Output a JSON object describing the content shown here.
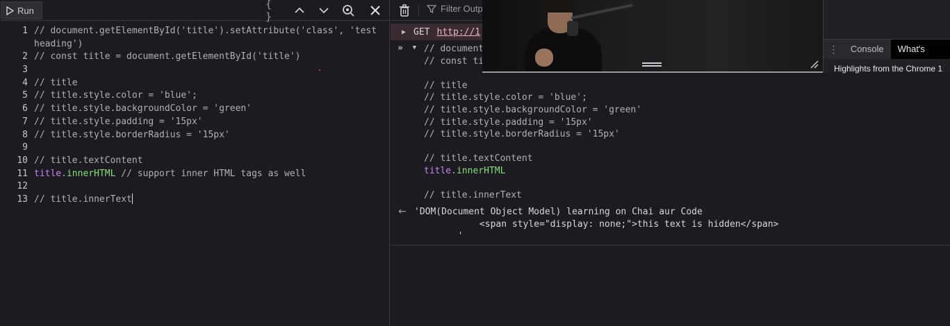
{
  "editor": {
    "run_label": "Run",
    "lines": [
      {
        "num": "1",
        "text": "// document.getElementById('title').setAttribute('class', 'test"
      },
      {
        "num": "",
        "text": "heading')"
      },
      {
        "num": "2",
        "text": "// const title = document.getElementById('title')"
      },
      {
        "num": "3",
        "text": ""
      },
      {
        "num": "4",
        "text": "// title"
      },
      {
        "num": "5",
        "text": "// title.style.color = 'blue';"
      },
      {
        "num": "6",
        "text": "// title.style.backgroundColor = 'green'"
      },
      {
        "num": "7",
        "text": "// title.style.padding = '15px'"
      },
      {
        "num": "8",
        "text": "// title.style.borderRadius = '15px'"
      },
      {
        "num": "9",
        "text": ""
      },
      {
        "num": "10",
        "text": "// title.textContent"
      },
      {
        "num": "11",
        "ident": "title",
        "dot": ".",
        "prop": "innerHTML",
        "rest": " // support inner HTML tags as well"
      },
      {
        "num": "12",
        "text": ""
      },
      {
        "num": "13",
        "text": "// title.innerText"
      }
    ]
  },
  "console": {
    "filter_placeholder": "Filter Outp",
    "net_method": "GET",
    "net_url": "http://1",
    "input_lines": [
      "// document",
      "// const ti",
      "",
      "// title",
      "// title.style.color = 'blue';",
      "// title.style.backgroundColor = 'green'",
      "// title.style.padding = '15px'",
      "// title.style.borderRadius = '15px'",
      "",
      "// title.textContent",
      "__INNERHTML__",
      "",
      "// title.innerText"
    ],
    "inner_ident": "title",
    "inner_dot": ".",
    "inner_prop": "innerHTML",
    "result_line1": "'DOM(Document Object Model) learning on Chai aur Code",
    "result_line2": "            <span style=\"display: none;\">this text is hidden</span>",
    "result_line3": "        '"
  },
  "drawer": {
    "tab_console": "Console",
    "tab_whats_new": "What's New",
    "body_text": "Highlights from the Chrome 1"
  },
  "colors": {
    "background": "#1c1b22",
    "identifier": "#c586f0",
    "property": "#86de74",
    "error_row": "#3a2b31"
  }
}
